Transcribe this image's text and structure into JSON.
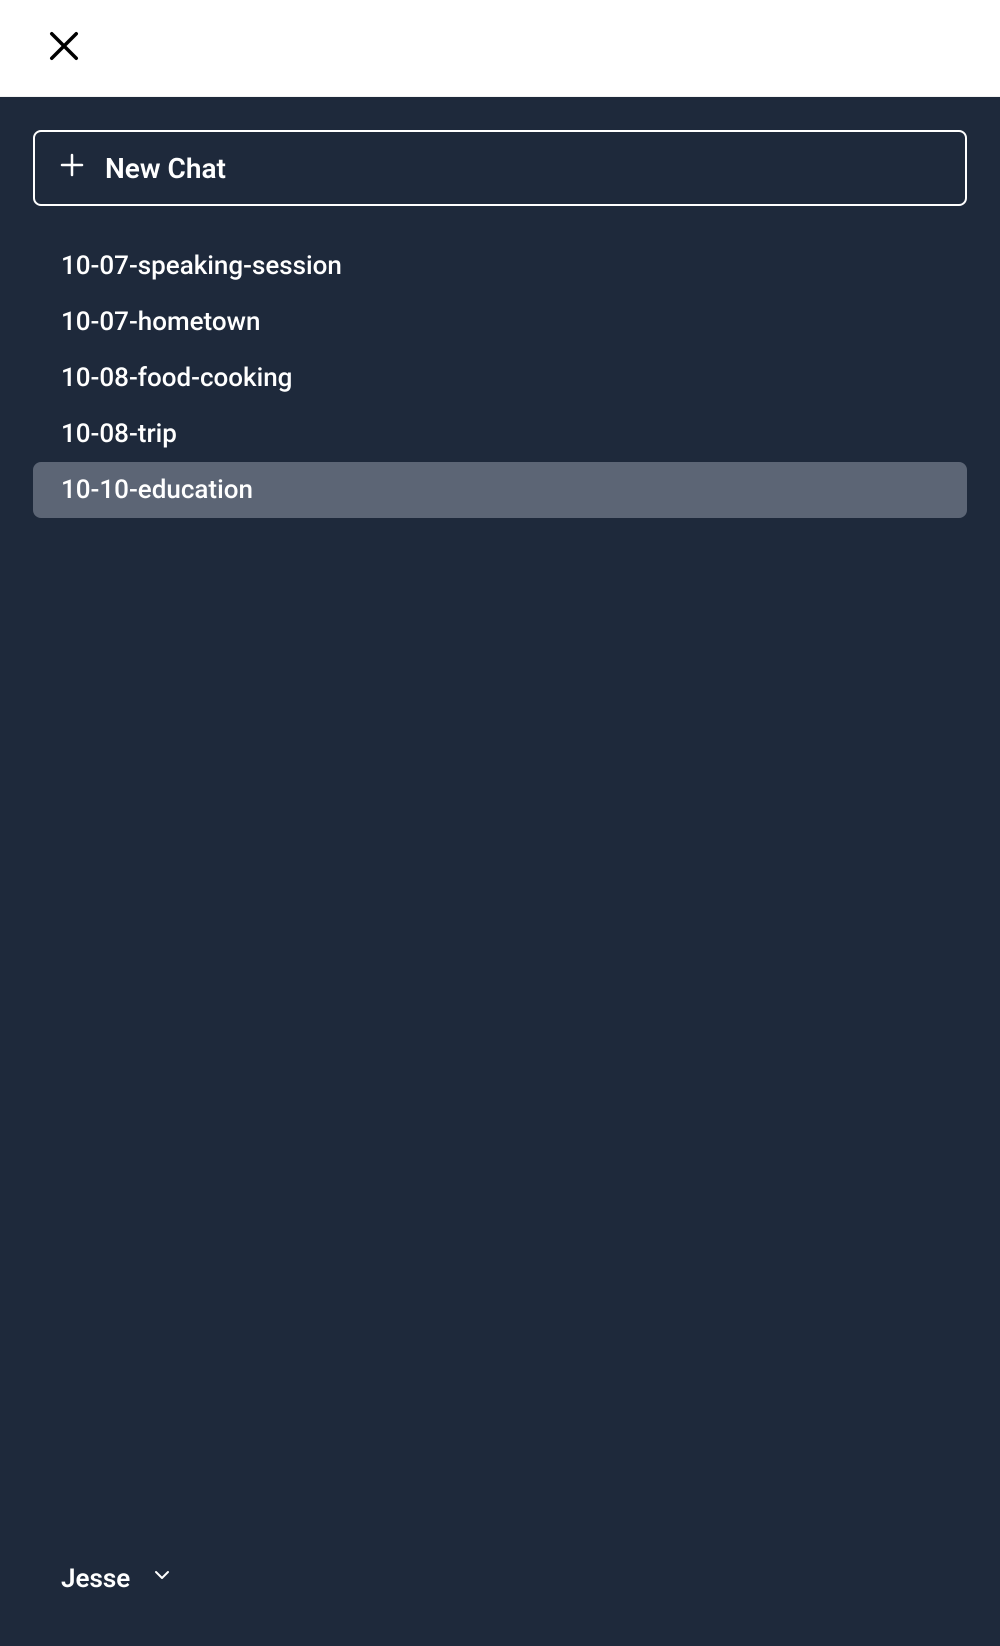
{
  "newChat": {
    "label": "New Chat"
  },
  "conversations": [
    {
      "label": "10-07-speaking-session",
      "selected": false
    },
    {
      "label": "10-07-hometown",
      "selected": false
    },
    {
      "label": "10-08-food-cooking",
      "selected": false
    },
    {
      "label": "10-08-trip",
      "selected": false
    },
    {
      "label": "10-10-education",
      "selected": true
    }
  ],
  "user": {
    "name": "Jesse"
  }
}
